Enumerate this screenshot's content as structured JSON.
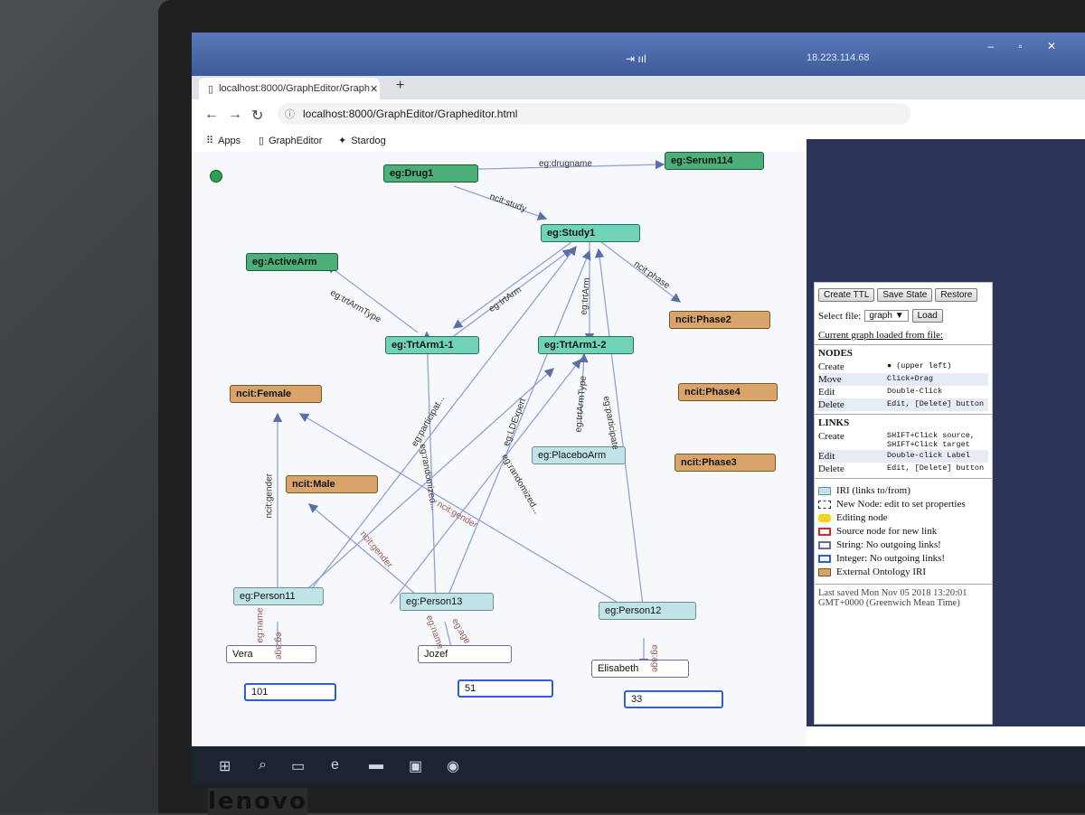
{
  "os": {
    "ip": "18.223.114.68",
    "signal": "⇥ ııl",
    "win_buttons": "– ▫ ✕"
  },
  "browser": {
    "tab_title": "localhost:8000/GraphEditor/Graph",
    "tab_close": "✕",
    "new_tab": "+",
    "url": "localhost:8000/GraphEditor/Grapheditor.html",
    "bookmarks": {
      "apps": "Apps",
      "grapheditor": "GraphEditor",
      "stardog": "Stardog"
    }
  },
  "graph": {
    "nodes": {
      "drug1": "eg:Drug1",
      "serum114": "eg:Serum114",
      "study1": "eg:Study1",
      "activearm": "eg:ActiveArm",
      "phase2": "ncit:Phase2",
      "trtarm11": "eg:TrtArm1-1",
      "trtarm12": "eg:TrtArm1-2",
      "female": "ncit:Female",
      "phase4": "ncit:Phase4",
      "placeboarm": "eg:PlaceboArm",
      "phase3": "ncit:Phase3",
      "male": "ncit:Male",
      "person11": "eg:Person11",
      "person13": "eg:Person13",
      "person12": "eg:Person12",
      "vera": "Vera",
      "jozef": "Jozef",
      "elisabeth": "Elisabeth",
      "age101": "101",
      "age51": "51",
      "age33": "33"
    },
    "edge_labels": {
      "drugname": "eg:drugname",
      "study": "ncit:study",
      "phase": "ncit:phase",
      "trtarm_a": "eg:trtArm",
      "trtarm_b": "eg:trtArm",
      "trtarmtype_a": "eg:trtArmType",
      "trtarmtype_b": "eg:trtArmType",
      "participat": "eg:participat...",
      "ldexpert": "eg:LDExpert",
      "participate2": "eg:participate",
      "randomized_a": "eg:randomized...",
      "randomized_b": "eg:randomized...",
      "gender_a": "ncit:gender",
      "gender_b": "ncit:gender",
      "gender_c": "ncit:gender",
      "age_a": "eg:age",
      "age_b": "eg:age",
      "age_c": "eg:age",
      "name_a": "eg:name",
      "name_b": "eg:name"
    }
  },
  "panel": {
    "buttons": {
      "create_ttl": "Create TTL",
      "save_state": "Save State",
      "restore": "Restore"
    },
    "select_file_label": "Select file:",
    "select_value": "graph ▼",
    "load": "Load",
    "current_graph": "Current graph loaded from file:",
    "nodes": {
      "title": "NODES",
      "rows": [
        {
          "k": "Create",
          "v": "● (upper left)"
        },
        {
          "k": "Move",
          "v": "Click+Drag"
        },
        {
          "k": "Edit",
          "v": "Double-Click"
        },
        {
          "k": "Delete",
          "v": "Edit, [Delete] button"
        }
      ]
    },
    "links": {
      "title": "LINKS",
      "rows": [
        {
          "k": "Create",
          "v": "SHIFT+Click source, SHIFT+Click target"
        },
        {
          "k": "Edit",
          "v": "Double-click Label"
        },
        {
          "k": "Delete",
          "v": "Edit, [Delete] button"
        }
      ]
    },
    "legend": [
      "IRI (links to/from)",
      "New Node: edit to set properties",
      "Editing node",
      "Source node for new link",
      "String: No outgoing links!",
      "Integer: No outgoing links!",
      "External Ontology IRI"
    ],
    "legend_colors": [
      "#bfe3e6",
      "#ffffff",
      "#f2d31b",
      "#ffffff",
      "#ffffff",
      "#ffffff",
      "#d9a46a"
    ],
    "last_saved": "Last saved Mon Nov 05 2018 13:20:01 GMT+0000 (Greenwich Mean Time)"
  },
  "laptop": {
    "brand": "lenovo"
  }
}
